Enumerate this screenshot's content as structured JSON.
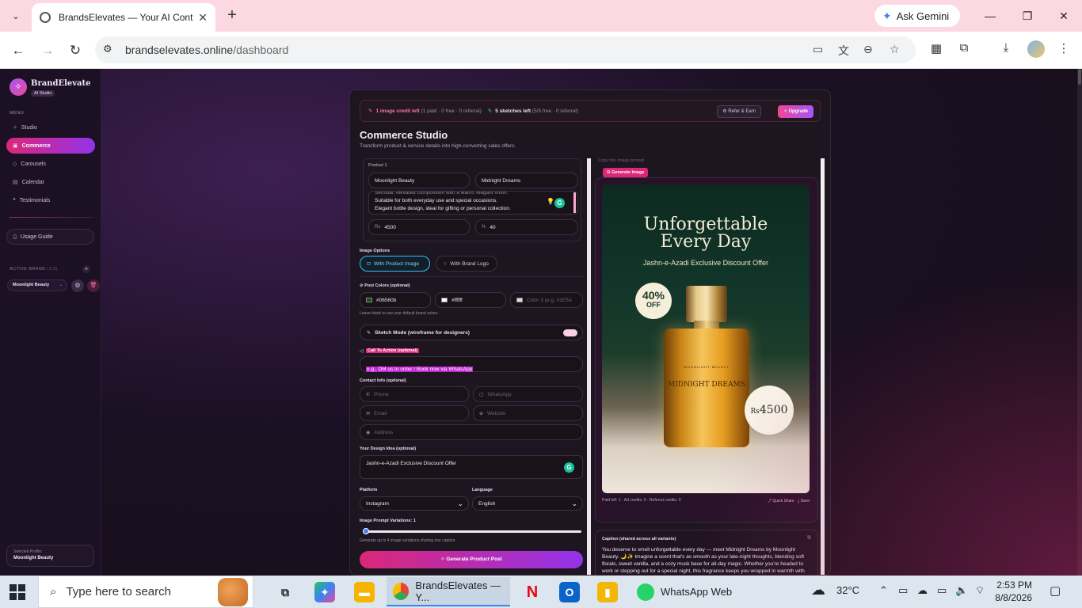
{
  "browser": {
    "tab_title": "BrandsElevates — Your AI Cont",
    "gemini_label": "Ask Gemini",
    "url_host": "brandselevates.online",
    "url_path": "/dashboard"
  },
  "sidebar": {
    "brand_name": "BrandElevate",
    "brand_tag": "AI Studio",
    "menu_label": "MENU",
    "items": [
      {
        "label": "Studio",
        "icon": "sparkle-icon"
      },
      {
        "label": "Commerce",
        "icon": "bag-icon"
      },
      {
        "label": "Carousels",
        "icon": "layers-icon"
      },
      {
        "label": "Calendar",
        "icon": "calendar-icon"
      },
      {
        "label": "Testimonials",
        "icon": "quote-icon"
      }
    ],
    "guide_label": "Usage Guide",
    "active_brand_label": "ACTIVE BRAND",
    "active_brand_count": "(1/3)",
    "active_brand_value": "Moonlight Beauty",
    "profile_label": "Selected Profile:",
    "profile_value": "Moonlight Beauty"
  },
  "credits": {
    "image_credit": "1 image credit left",
    "image_detail": "(1 paid · 0 free · 0 referral)",
    "sketches": "5 sketches left",
    "sketch_detail": "(5/5 free · 0 referral)",
    "refer_label": "Refer & Earn",
    "upgrade_label": "Upgrade"
  },
  "studio": {
    "title": "Commerce Studio",
    "subtitle": "Transform product & service details into high-converting sales offers."
  },
  "form": {
    "product_label": "Product 1",
    "brand_value": "Moonlight Beauty",
    "product_value": "Midnight Dreams",
    "description_line0": "Sensual, elevated composition with a warm, elegant finish.",
    "description_line1": "Suitable for both everyday use and special occasions.",
    "description_line2": "Elegant bottle design, ideal for gifting or personal collection.",
    "price_prefix": "Rs",
    "price_value": "4500",
    "discount_prefix": "%",
    "discount_value": "40",
    "image_options_label": "Image Options",
    "opt_product_image": "With Product Image",
    "opt_brand_logo": "With Brand Logo",
    "post_colors_label": "Post Colors (optional)",
    "color1": "#06560b",
    "color2": "#ffffff",
    "color3_placeholder": "Color 3 (e.g. #1E5A",
    "colors_hint": "Leave blank to use your default brand colors.",
    "sketch_mode_label": "Sketch Mode (wireframe for designers)",
    "cta_label": "Call To Action (optional)",
    "cta_placeholder": "e.g., DM us to order / Book now via WhatsApp",
    "contact_label": "Contact Info (optional)",
    "phone_placeholder": "Phone",
    "whatsapp_placeholder": "WhatsApp",
    "email_placeholder": "Email",
    "website_placeholder": "Website",
    "address_placeholder": "Address",
    "design_idea_label": "Your Design Idea (optional)",
    "design_idea_value": "Jashn-e-Azadi Exclusive Discount Offer",
    "platform_label": "Platform",
    "platform_value": "Instagram",
    "language_label": "Language",
    "language_value": "English",
    "variations_label": "Image Prompt Variations: 1",
    "variations_value": 1,
    "variations_max": 4,
    "variations_hint": "Generate up to 4 image variations sharing one caption.",
    "generate_label": "Generate Product Post"
  },
  "preview": {
    "clip_text": "Copy this image prompt",
    "generate_image_label": "Generate Image",
    "poster_heading": "Unforgettable Every Day",
    "poster_sub": "Jashn-e-Azadi Exclusive Discount Offer",
    "badge_percent": "40%",
    "badge_off": "OFF",
    "bottle_brand": "MOONLIGHT BEAUTY",
    "bottle_name": "MIDNIGHT DREAMS",
    "price_currency": "Rs",
    "price_amount": "4500",
    "foot_left": "Paid left: 1 · Ad credits: 0 · Referral credits: 0",
    "quick_share": "Quick Share",
    "save": "Save",
    "caption_title": "Caption (shared across all variants)",
    "caption_text": "You deserve to smell unforgettable every day — meet Midnight Dreams by Moonlight Beauty. 🌙✨ Imagine a scent that's as smooth as your late-night thoughts, blending soft florals, sweet vanilla, and a cozy musk base for all-day magic. Whether you're headed to work or stepping out for a special night, this fragrance keeps you wrapped in warmth with its elegant, balanced finish."
  },
  "taskbar": {
    "search_text": "Type here to search",
    "chrome_label": "BrandsElevates — Y...",
    "whatsapp_label": "WhatsApp Web",
    "temperature": "32°C",
    "time": "2:53 PM",
    "date": "8/8/2026"
  }
}
